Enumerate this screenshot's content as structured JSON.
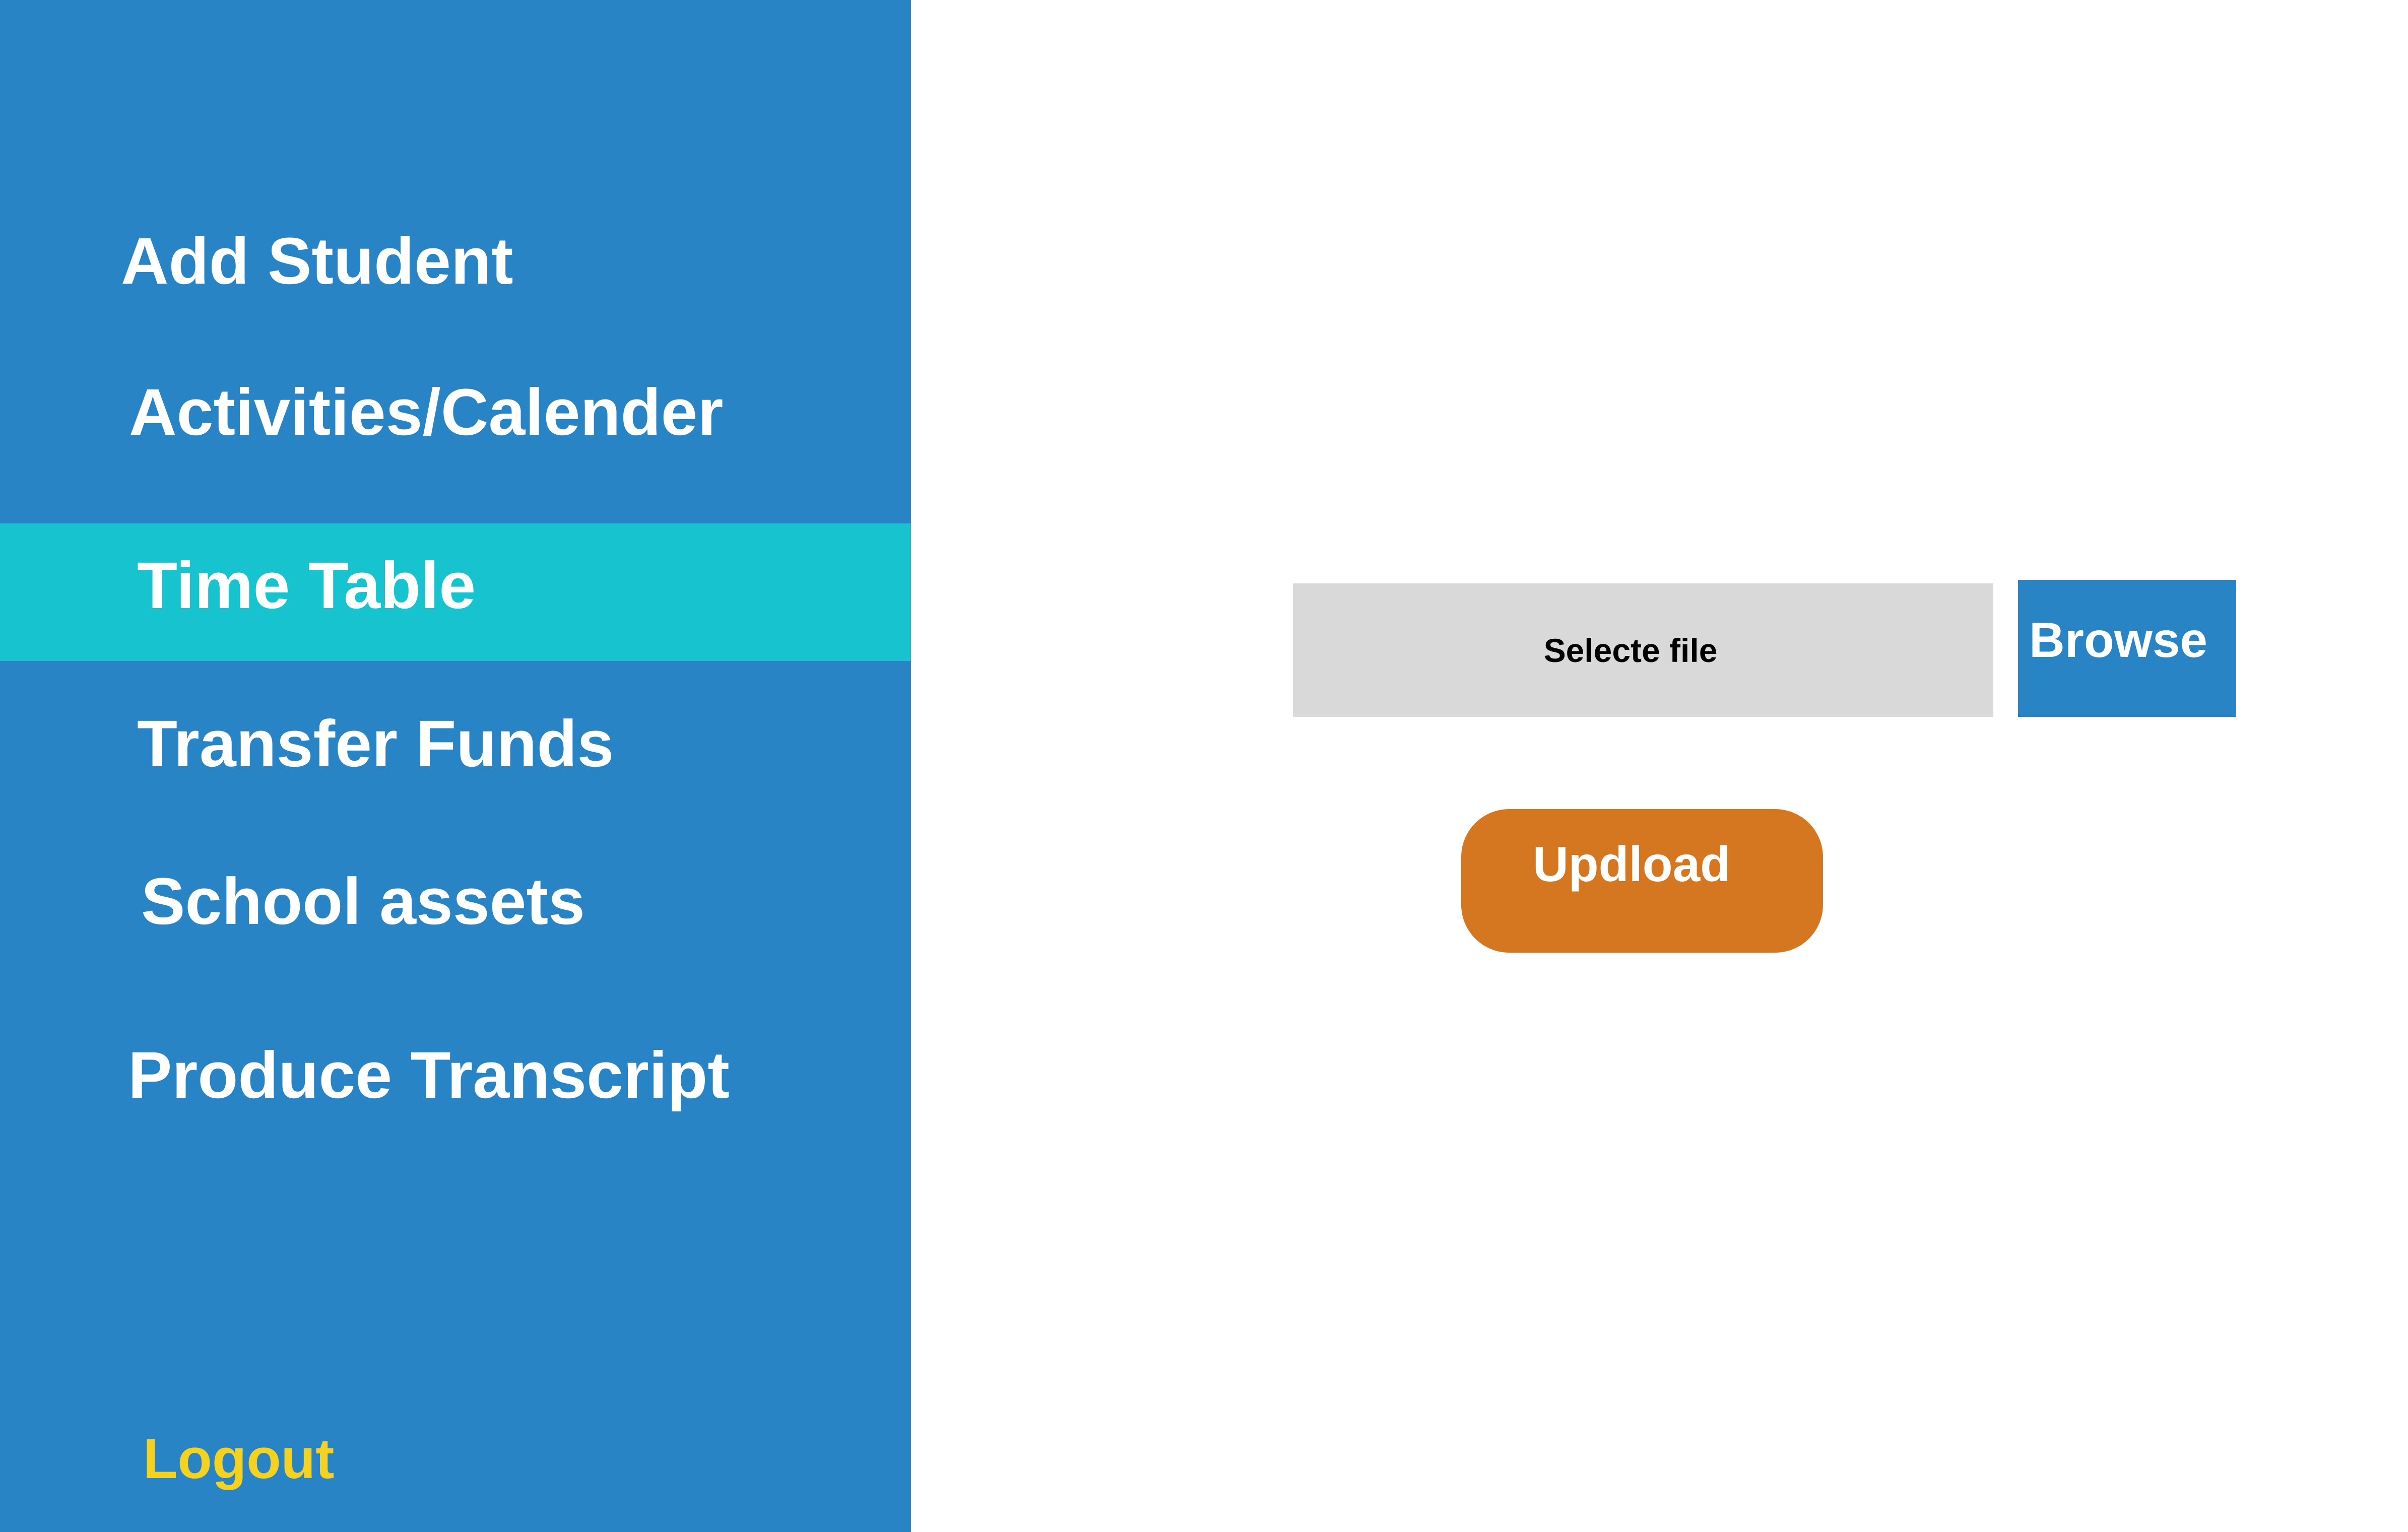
{
  "sidebar": {
    "items": [
      {
        "label": "Add Student",
        "active": false
      },
      {
        "label": "Activities/Calender",
        "active": false
      },
      {
        "label": "Time Table",
        "active": true
      },
      {
        "label": "Transfer Funds",
        "active": false
      },
      {
        "label": "School assets",
        "active": false
      },
      {
        "label": "Produce Transcript",
        "active": false
      }
    ],
    "logout_label": "Logout"
  },
  "upload": {
    "file_placeholder": "Selecte file",
    "browse_label": "Browse",
    "upload_label": "Updload"
  },
  "colors": {
    "sidebar_bg": "#2884C5",
    "active_item_bg": "#17C3CF",
    "logout_text": "#F4D21F",
    "file_field_bg": "#D9D9D9",
    "browse_bg": "#2884C5",
    "upload_bg": "#D57721"
  }
}
